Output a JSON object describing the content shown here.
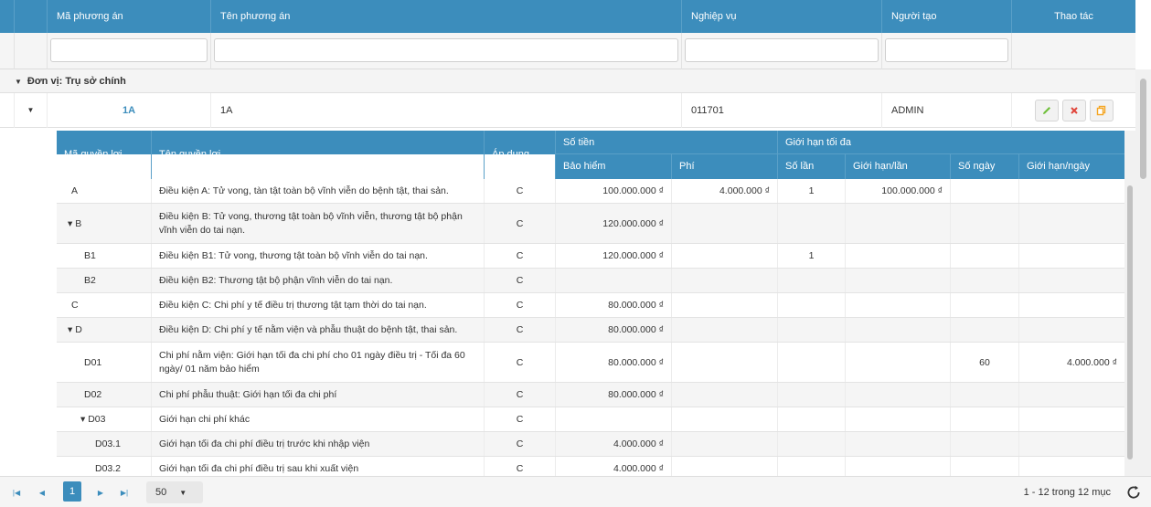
{
  "grid": {
    "columns": {
      "code": "Mã phương án",
      "name": "Tên phương án",
      "operation": "Nghiệp vụ",
      "creator": "Người tạo",
      "actions": "Thao tác"
    },
    "group_label": "Đơn vị: Trụ sở chính",
    "master_row": {
      "code": "1A",
      "name": "1A",
      "operation": "011701",
      "creator": "ADMIN"
    }
  },
  "detail": {
    "headers": {
      "benefit_code": "Mã quyền lợi",
      "benefit_name": "Tên quyền lợi",
      "apply": "Áp dụng",
      "amount_group": "Số tiền",
      "insurance": "Bảo hiểm",
      "fee": "Phí",
      "limit_group": "Giới hạn tối đa",
      "times": "Số lần",
      "limit_per_time": "Giới hạn/lần",
      "days": "Số ngày",
      "limit_per_day": "Giới hạn/ngày"
    },
    "rows": [
      {
        "code": "A",
        "name": "Điều kiện A: Tử vong, tàn tật toàn bộ vĩnh viễn do bệnh tật, thai sản.",
        "apply": "C",
        "insurance": "100.000.000 ₫",
        "fee": "4.000.000 ₫",
        "times": "1",
        "limit_per_time": "100.000.000 ₫",
        "days": "",
        "limit_per_day": ""
      },
      {
        "code": "▾ B",
        "name": "Điều kiện B: Tử vong, thương tật toàn bộ vĩnh viễn, thương tật bộ phận vĩnh viễn do tai nạn.",
        "apply": "C",
        "insurance": "120.000.000 ₫",
        "fee": "",
        "times": "",
        "limit_per_time": "",
        "days": "",
        "limit_per_day": ""
      },
      {
        "code": "B1",
        "name": "Điều kiện B1: Tử vong, thương tật toàn bộ vĩnh viễn do tai nạn.",
        "apply": "C",
        "insurance": "120.000.000 ₫",
        "fee": "",
        "times": "1",
        "limit_per_time": "",
        "days": "",
        "limit_per_day": ""
      },
      {
        "code": "B2",
        "name": "Điều kiện B2: Thương tật bộ phận vĩnh viễn do tai nạn.",
        "apply": "C",
        "insurance": "",
        "fee": "",
        "times": "",
        "limit_per_time": "",
        "days": "",
        "limit_per_day": ""
      },
      {
        "code": "C",
        "name": "Điều kiện C: Chi phí y tế điều trị thương tật tạm thời do tai nạn.",
        "apply": "C",
        "insurance": "80.000.000 ₫",
        "fee": "",
        "times": "",
        "limit_per_time": "",
        "days": "",
        "limit_per_day": ""
      },
      {
        "code": "▾ D",
        "name": "Điều kiện D: Chi phí y tế nằm viện và phẫu thuật do bệnh tật, thai sản.",
        "apply": "C",
        "insurance": "80.000.000 ₫",
        "fee": "",
        "times": "",
        "limit_per_time": "",
        "days": "",
        "limit_per_day": ""
      },
      {
        "code": "D01",
        "name": "Chi phí nằm viện: Giới hạn tối đa chi phí cho 01 ngày điều trị - Tối đa 60 ngày/ 01 năm bảo hiểm",
        "apply": "C",
        "insurance": "80.000.000 ₫",
        "fee": "",
        "times": "",
        "limit_per_time": "",
        "days": "60",
        "limit_per_day": "4.000.000 ₫"
      },
      {
        "code": "D02",
        "name": "Chi phí phẫu thuật: Giới hạn tối đa chi phí",
        "apply": "C",
        "insurance": "80.000.000 ₫",
        "fee": "",
        "times": "",
        "limit_per_time": "",
        "days": "",
        "limit_per_day": ""
      },
      {
        "code": "▾ D03",
        "name": "Giới hạn chi phí khác",
        "apply": "C",
        "insurance": "",
        "fee": "",
        "times": "",
        "limit_per_time": "",
        "days": "",
        "limit_per_day": ""
      },
      {
        "code": "D03.1",
        "name": "Giới hạn tối đa chi phí điều trị trước khi nhập viện",
        "apply": "C",
        "insurance": "4.000.000 ₫",
        "fee": "",
        "times": "",
        "limit_per_time": "",
        "days": "",
        "limit_per_day": ""
      },
      {
        "code": "D03.2",
        "name": "Giới hạn tối đa chi phí điều trị sau khi xuất viện",
        "apply": "C",
        "insurance": "4.000.000 ₫",
        "fee": "",
        "times": "",
        "limit_per_time": "",
        "days": "",
        "limit_per_day": ""
      }
    ]
  },
  "pager": {
    "current_page": "1",
    "page_size": "50",
    "info": "1 - 12 trong 12 mục"
  },
  "icons": {
    "edit": "pencil-icon",
    "delete": "close-icon",
    "copy": "copy-icon",
    "refresh": "refresh-icon"
  },
  "colors": {
    "header": "#3c8dbc",
    "edit": "#6fbf3a",
    "delete": "#e0453a",
    "copy": "#f5a623"
  }
}
